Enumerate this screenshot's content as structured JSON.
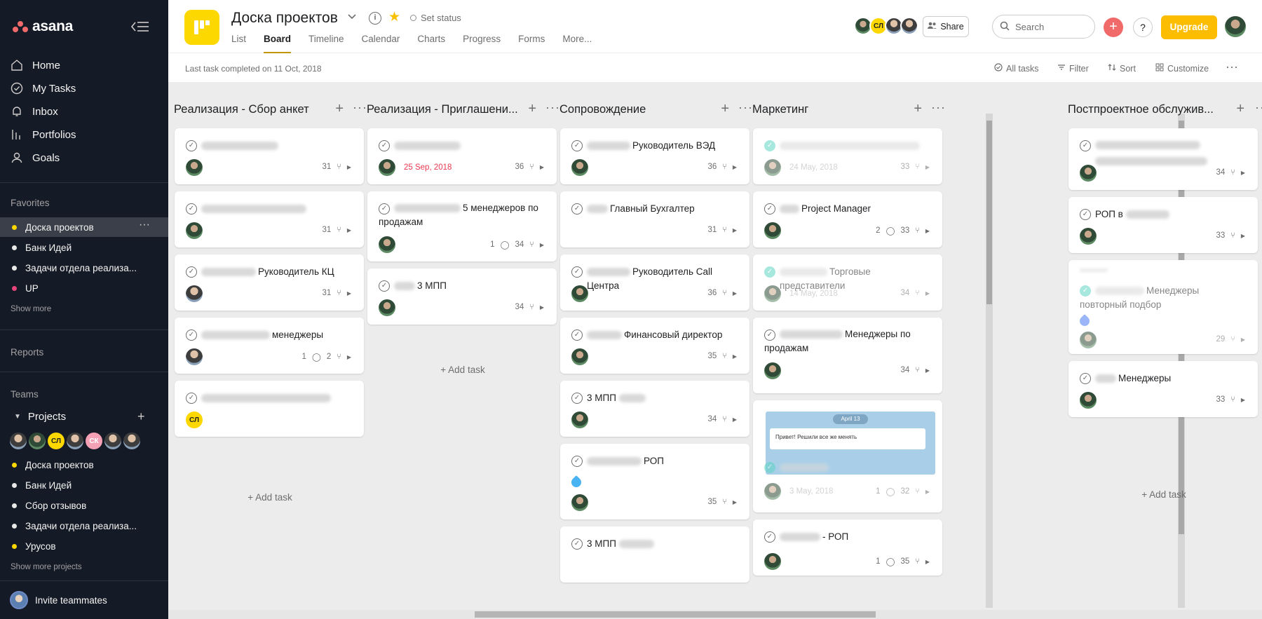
{
  "sidebar": {
    "logo": "asana",
    "nav": [
      "Home",
      "My Tasks",
      "Inbox",
      "Portfolios",
      "Goals"
    ],
    "favorites_label": "Favorites",
    "favorites": [
      {
        "label": "Доска проектов",
        "color": "#fcd800"
      },
      {
        "label": "Банк Идей",
        "color": "#e8e8e8"
      },
      {
        "label": "Задачи отдела реализа...",
        "color": "#e8e8e8"
      },
      {
        "label": "UP",
        "color": "#e8447c"
      }
    ],
    "show_more": "Show more",
    "reports_label": "Reports",
    "teams_label": "Teams",
    "team_name": "Projects",
    "team_avatars": [
      "",
      "",
      "СЛ",
      "",
      "СК",
      "",
      ""
    ],
    "projects": [
      {
        "label": "Доска проектов",
        "color": "#fcd800"
      },
      {
        "label": "Банк Идей",
        "color": "#e8e8e8"
      },
      {
        "label": "Сбор отзывов",
        "color": "#e8e8e8"
      },
      {
        "label": "Задачи отдела реализа...",
        "color": "#e8e8e8"
      },
      {
        "label": "Урусов",
        "color": "#fcd800"
      }
    ],
    "show_more_projects": "Show more projects",
    "invite": "Invite teammates"
  },
  "header": {
    "title": "Доска проектов",
    "set_status": "Set status",
    "tabs": [
      "List",
      "Board",
      "Timeline",
      "Calendar",
      "Charts",
      "Progress",
      "Forms",
      "More..."
    ],
    "active_tab": "Board",
    "member_avatars": [
      "",
      "СЛ",
      "",
      ""
    ],
    "share": "Share",
    "search_placeholder": "Search",
    "help": "?",
    "upgrade": "Upgrade"
  },
  "subbar": {
    "last_task": "Last task completed on 11 Oct, 2018",
    "all_tasks": "All tasks",
    "filter": "Filter",
    "sort": "Sort",
    "customize": "Customize"
  },
  "board": {
    "add_task": "Add task",
    "columns": [
      {
        "name": "Реализация - Сбор анкет",
        "cards": [
          {
            "title": "",
            "subtasks": "31"
          },
          {
            "title": "",
            "subtasks": "31"
          },
          {
            "title": "Руководитель КЦ",
            "subtasks": "31"
          },
          {
            "title": "менеджеры",
            "comments": "1",
            "subtasks": "2"
          },
          {
            "title": "",
            "avatar": "СЛ"
          }
        ]
      },
      {
        "name": "Реализация - Приглашени...",
        "cards": [
          {
            "title": "",
            "date": "25 Sep, 2018",
            "subtasks": "36"
          },
          {
            "title": "5 менеджеров по продажам",
            "comments": "1",
            "subtasks": "34"
          },
          {
            "title": "3 МПП",
            "subtasks": "34"
          }
        ]
      },
      {
        "name": "Сопровождение",
        "cards": [
          {
            "title": "Руководитель ВЭД",
            "subtasks": "36"
          },
          {
            "title": "Главный Бухгалтер",
            "subtasks": "31"
          },
          {
            "title": "Руководитель Call Центра",
            "subtasks": "36"
          },
          {
            "title": "Финансовый директор",
            "subtasks": "35"
          },
          {
            "title": "3 МПП",
            "subtasks": "34"
          },
          {
            "title": "РОП",
            "subtasks": "35"
          },
          {
            "title": "3 МПП",
            "subtasks": ""
          }
        ]
      },
      {
        "name": "Маркетинг",
        "cards": [
          {
            "title": "",
            "date": "24 May, 2018",
            "subtasks": "33"
          },
          {
            "title": "Project Manager",
            "comments": "2",
            "subtasks": "33"
          },
          {
            "title": "Торговые представители",
            "date": "14 May, 2018",
            "subtasks": "34"
          },
          {
            "title": "Менеджеры по продажам",
            "subtasks": "34"
          },
          {
            "title": "",
            "date": "3 May, 2018",
            "comments": "1",
            "subtasks": "32",
            "image_date": "April 13",
            "image_text": "Привет! Решили все же менять"
          },
          {
            "title": "- РОП",
            "comments": "1",
            "subtasks": "35"
          }
        ]
      },
      {
        "name": "Постпроектное обслужив...",
        "cards": [
          {
            "title": "",
            "subtasks": "34"
          },
          {
            "title": "РОП в",
            "subtasks": "33"
          },
          {
            "title": "Менеджеры повторный подбор",
            "subtasks": "29"
          },
          {
            "title": "Менеджеры",
            "subtasks": "33"
          }
        ]
      }
    ]
  }
}
